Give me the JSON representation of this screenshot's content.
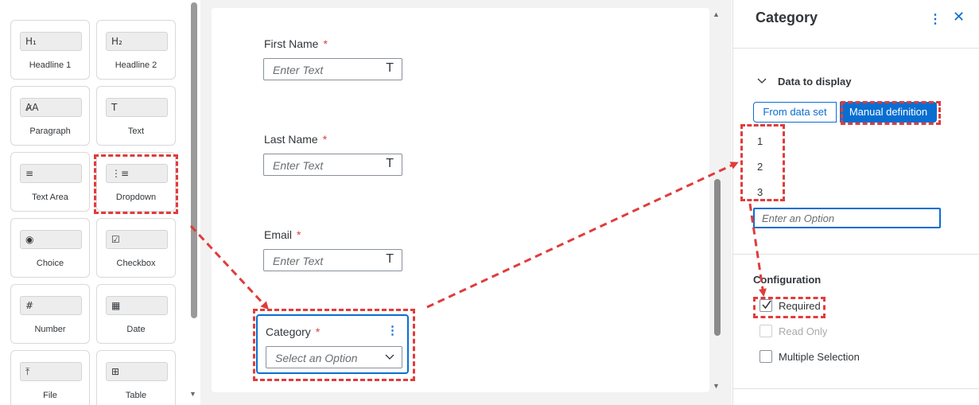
{
  "palette": {
    "tiles": [
      {
        "label": "Headline 1",
        "icon": "H₁",
        "icon_name": "headline-1-icon"
      },
      {
        "label": "Headline 2",
        "icon": "H₂",
        "icon_name": "headline-2-icon"
      },
      {
        "label": "Paragraph",
        "icon": "A̷A",
        "icon_name": "paragraph-icon"
      },
      {
        "label": "Text",
        "icon": "T",
        "icon_name": "text-icon"
      },
      {
        "label": "Text Area",
        "icon": "≡",
        "icon_name": "text-area-icon"
      },
      {
        "label": "Dropdown",
        "icon": "⋮≡",
        "icon_name": "dropdown-icon"
      },
      {
        "label": "Choice",
        "icon": "◉",
        "icon_name": "radio-icon"
      },
      {
        "label": "Checkbox",
        "icon": "☑",
        "icon_name": "checkbox-icon"
      },
      {
        "label": "Number",
        "icon": "#",
        "icon_name": "number-icon"
      },
      {
        "label": "Date",
        "icon": "▦",
        "icon_name": "calendar-icon"
      },
      {
        "label": "File",
        "icon": "⤒",
        "icon_name": "upload-icon"
      },
      {
        "label": "Table",
        "icon": "⊞",
        "icon_name": "table-icon"
      }
    ]
  },
  "form": {
    "first_name_label": "First Name",
    "last_name_label": "Last Name",
    "email_label": "Email",
    "required_mark": "*",
    "text_placeholder": "Enter Text",
    "text_type_icon": "T",
    "category_label": "Category",
    "category_menu_icon": "⋮",
    "category_placeholder": "Select an Option"
  },
  "panel": {
    "title": "Category",
    "more_icon": "⋮",
    "close_icon": "✕",
    "data_section_title": "Data to display",
    "segment_from": "From data set",
    "segment_manual": "Manual definition",
    "options": [
      "1",
      "2",
      "3"
    ],
    "option_placeholder": "Enter an Option",
    "config_title": "Configuration",
    "checkboxes": [
      {
        "label": "Required",
        "checked": true,
        "disabled": false
      },
      {
        "label": "Read Only",
        "checked": false,
        "disabled": true
      },
      {
        "label": "Multiple Selection",
        "checked": false,
        "disabled": false
      }
    ]
  },
  "colors": {
    "accent": "#0a6ed1",
    "required": "#d04343",
    "annotation": "#e03c3c"
  }
}
